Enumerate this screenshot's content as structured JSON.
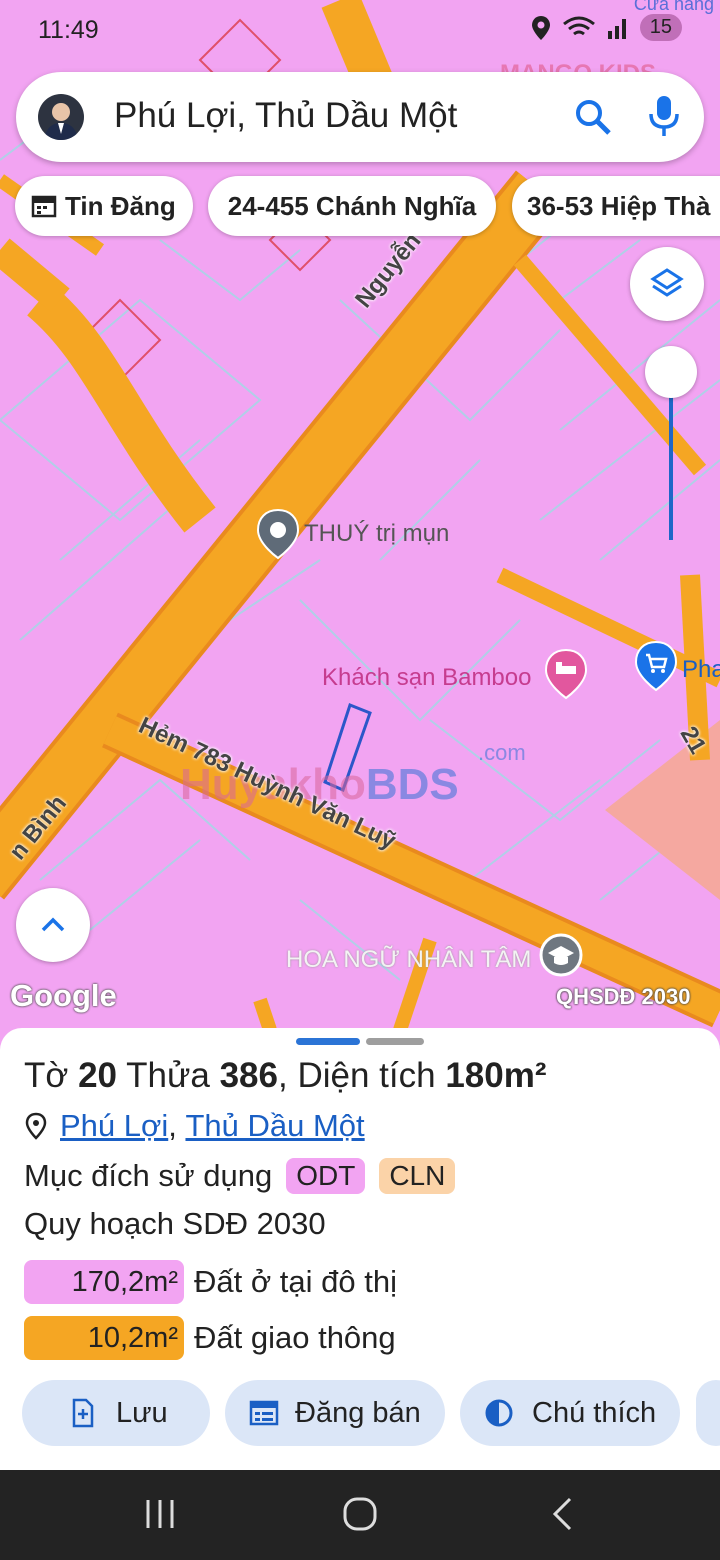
{
  "status_bar": {
    "time": "11:49",
    "notification_count": "15",
    "top_right_label": "Cửa hàng"
  },
  "search": {
    "query": "Phú Lợi, Thủ Dầu Một"
  },
  "chips": [
    {
      "label": "Tin Đăng",
      "icon": "calendar-icon"
    },
    {
      "label": "24-455 Chánh Nghĩa"
    },
    {
      "label": "36-53 Hiệp Thà"
    }
  ],
  "map": {
    "streets": {
      "nguyen_binh": "Nguyễn Bình",
      "nguyen_binh_left": "n Bình",
      "hem": "Hẻm 783 Huỳnh Văn Luỹ",
      "right_edge": "21"
    },
    "pois": {
      "thuy": "THUÝ trị mụn",
      "bamboo": "Khách sạn Bamboo",
      "pha": "Pha",
      "hoa_ngu": "HOA NGỮ NHÂN TÂM",
      "mango": "MANGO KIDS"
    },
    "watermark": {
      "part1": "Huyakho",
      "part2": "BDS",
      "com": ".com"
    },
    "google_logo": "Google",
    "plan_label": "QHSDĐ 2030",
    "colors": {
      "residential": "#f2a4f2",
      "road": "#f5a623",
      "lot_line": "#a9d4e6",
      "parcel_outline": "#2c57c9"
    }
  },
  "sheet": {
    "to_label": "Tờ",
    "to_value": "20",
    "thua_label": "Thửa",
    "thua_value": "386",
    "area_label": "Diện tích",
    "area_value": "180m²",
    "location_ward": "Phú Lợi",
    "location_city": "Thủ Dầu Một",
    "purpose_label": "Mục đích sử dụng",
    "purpose_tags": [
      {
        "code": "ODT",
        "color": "#f2a4f2"
      },
      {
        "code": "CLN",
        "color": "#fbd3a8"
      }
    ],
    "plan_title": "Quy hoạch SDĐ 2030",
    "plan_areas": [
      {
        "area": "170,2m²",
        "label": "Đất ở tại đô thị",
        "color": "#f2a4f2"
      },
      {
        "area": "10,2m²",
        "label": "Đất giao thông",
        "color": "#f5a623"
      }
    ],
    "actions": [
      {
        "label": "Lưu",
        "icon": "bookmark-add-icon"
      },
      {
        "label": "Đăng bán",
        "icon": "calendar-list-icon"
      },
      {
        "label": "Chú thích",
        "icon": "contrast-icon"
      }
    ]
  }
}
